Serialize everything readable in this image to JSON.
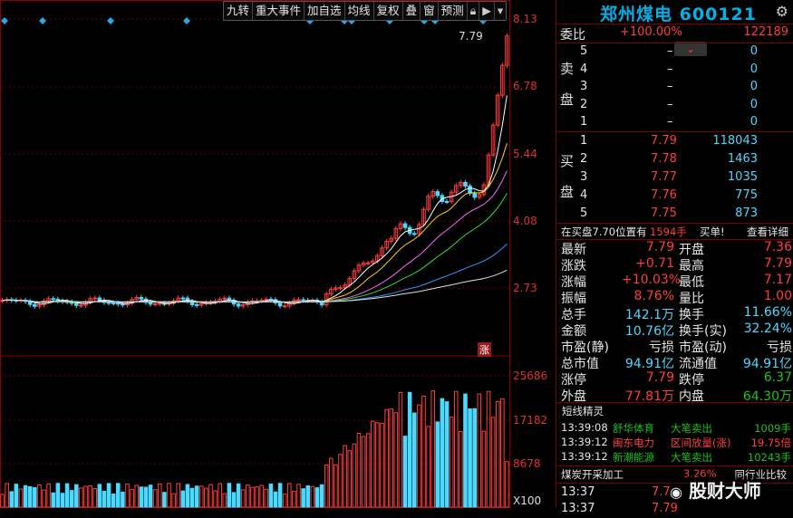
{
  "toolbar": {
    "items": [
      "九转",
      "重大事件",
      "加自选",
      "均线",
      "复权",
      "叠",
      "窗",
      "预测"
    ],
    "icons": [
      "lock-icon",
      "arrow-icon",
      "chevron-down-icon"
    ]
  },
  "price_axis": [
    "8.13",
    "6.78",
    "5.44",
    "4.08",
    "2.73"
  ],
  "chart_peak_label": "7.79",
  "limit_tag": "涨",
  "volume_axis": [
    "25686",
    "17182",
    "8678"
  ],
  "volume_unit": "X100",
  "stock": {
    "name": "郑州煤电",
    "code": "600121"
  },
  "weibi": {
    "label": "委比",
    "pct": "+100.00%",
    "diff": "122189"
  },
  "sell": {
    "label": "卖\n\n盘",
    "rows": [
      {
        "level": "5",
        "price": "–",
        "vol": "0"
      },
      {
        "level": "4",
        "price": "–",
        "vol": "0"
      },
      {
        "level": "3",
        "price": "–",
        "vol": "0"
      },
      {
        "level": "2",
        "price": "–",
        "vol": "0"
      },
      {
        "level": "1",
        "price": "–",
        "vol": "0"
      }
    ]
  },
  "buy": {
    "label": "买\n\n盘",
    "rows": [
      {
        "level": "1",
        "price": "7.79",
        "vol": "118043"
      },
      {
        "level": "2",
        "price": "7.78",
        "vol": "1463"
      },
      {
        "level": "3",
        "price": "7.77",
        "vol": "1035"
      },
      {
        "level": "4",
        "price": "7.76",
        "vol": "775"
      },
      {
        "level": "5",
        "price": "7.75",
        "vol": "873"
      }
    ]
  },
  "notice": {
    "text": "在买盘7.70位置有",
    "vol": "1594手",
    "tag": "买单!",
    "link": "查看详细"
  },
  "stats": [
    {
      "l": "最新",
      "v": "7.79",
      "vc": "red",
      "l2": "开盘",
      "v2": "7.36",
      "v2c": "red"
    },
    {
      "l": "涨跌",
      "v": "+0.71",
      "vc": "red",
      "l2": "最高",
      "v2": "7.79",
      "v2c": "red"
    },
    {
      "l": "涨幅",
      "v": "+10.03%",
      "vc": "red",
      "l2": "最低",
      "v2": "7.17",
      "v2c": "red"
    },
    {
      "l": "振幅",
      "v": "8.76%",
      "vc": "red",
      "l2": "量比",
      "v2": "1.00",
      "v2c": "red"
    },
    {
      "l": "总手",
      "v": "142.1万",
      "vc": "cyan",
      "l2": "换手",
      "v2": "11.66%",
      "v2c": "cyan"
    },
    {
      "l": "金额",
      "v": "10.76亿",
      "vc": "cyan",
      "l2": "换手(实)",
      "v2": "32.24%",
      "v2c": "cyan"
    },
    {
      "l": "市盈(静)",
      "v": "亏损",
      "vc": "white",
      "l2": "市盈(动)",
      "v2": "亏损",
      "v2c": "white"
    },
    {
      "l": "总市值",
      "v": "94.91亿",
      "vc": "cyan",
      "l2": "流通值",
      "v2": "94.91亿",
      "v2c": "cyan"
    },
    {
      "l": "涨停",
      "v": "7.79",
      "vc": "red",
      "l2": "跌停",
      "v2": "6.37",
      "v2c": "green"
    },
    {
      "l": "外盘",
      "v": "77.81万",
      "vc": "red",
      "l2": "内盘",
      "v2": "64.30万",
      "v2c": "green"
    }
  ],
  "shortline": {
    "title": "短线精灵",
    "rows": [
      {
        "time": "13:39:08",
        "name": "舒华体育",
        "event": "大笔卖出",
        "value": "1009手",
        "color": "green"
      },
      {
        "time": "13:39:12",
        "name": "闽东电力",
        "event": "区间放量(涨)",
        "value": "19.75倍",
        "color": "red"
      },
      {
        "time": "13:39:12",
        "name": "新潮能源",
        "event": "大笔卖出",
        "value": "10243手",
        "color": "green"
      }
    ]
  },
  "sector": {
    "name": "煤炭开采加工",
    "pct": "3.26%",
    "compare": "同行业比较"
  },
  "ticks": [
    {
      "time": "13:37",
      "price": "7.7"
    },
    {
      "time": "13:37",
      "price": "7.79"
    }
  ],
  "watermark": "股财大师",
  "chart_data": {
    "type": "candlestick",
    "y_ticks": [
      8.13,
      6.78,
      5.44,
      4.08,
      2.73
    ],
    "volume_ticks": [
      25686,
      17182,
      8678
    ],
    "last_price": 7.79
  }
}
